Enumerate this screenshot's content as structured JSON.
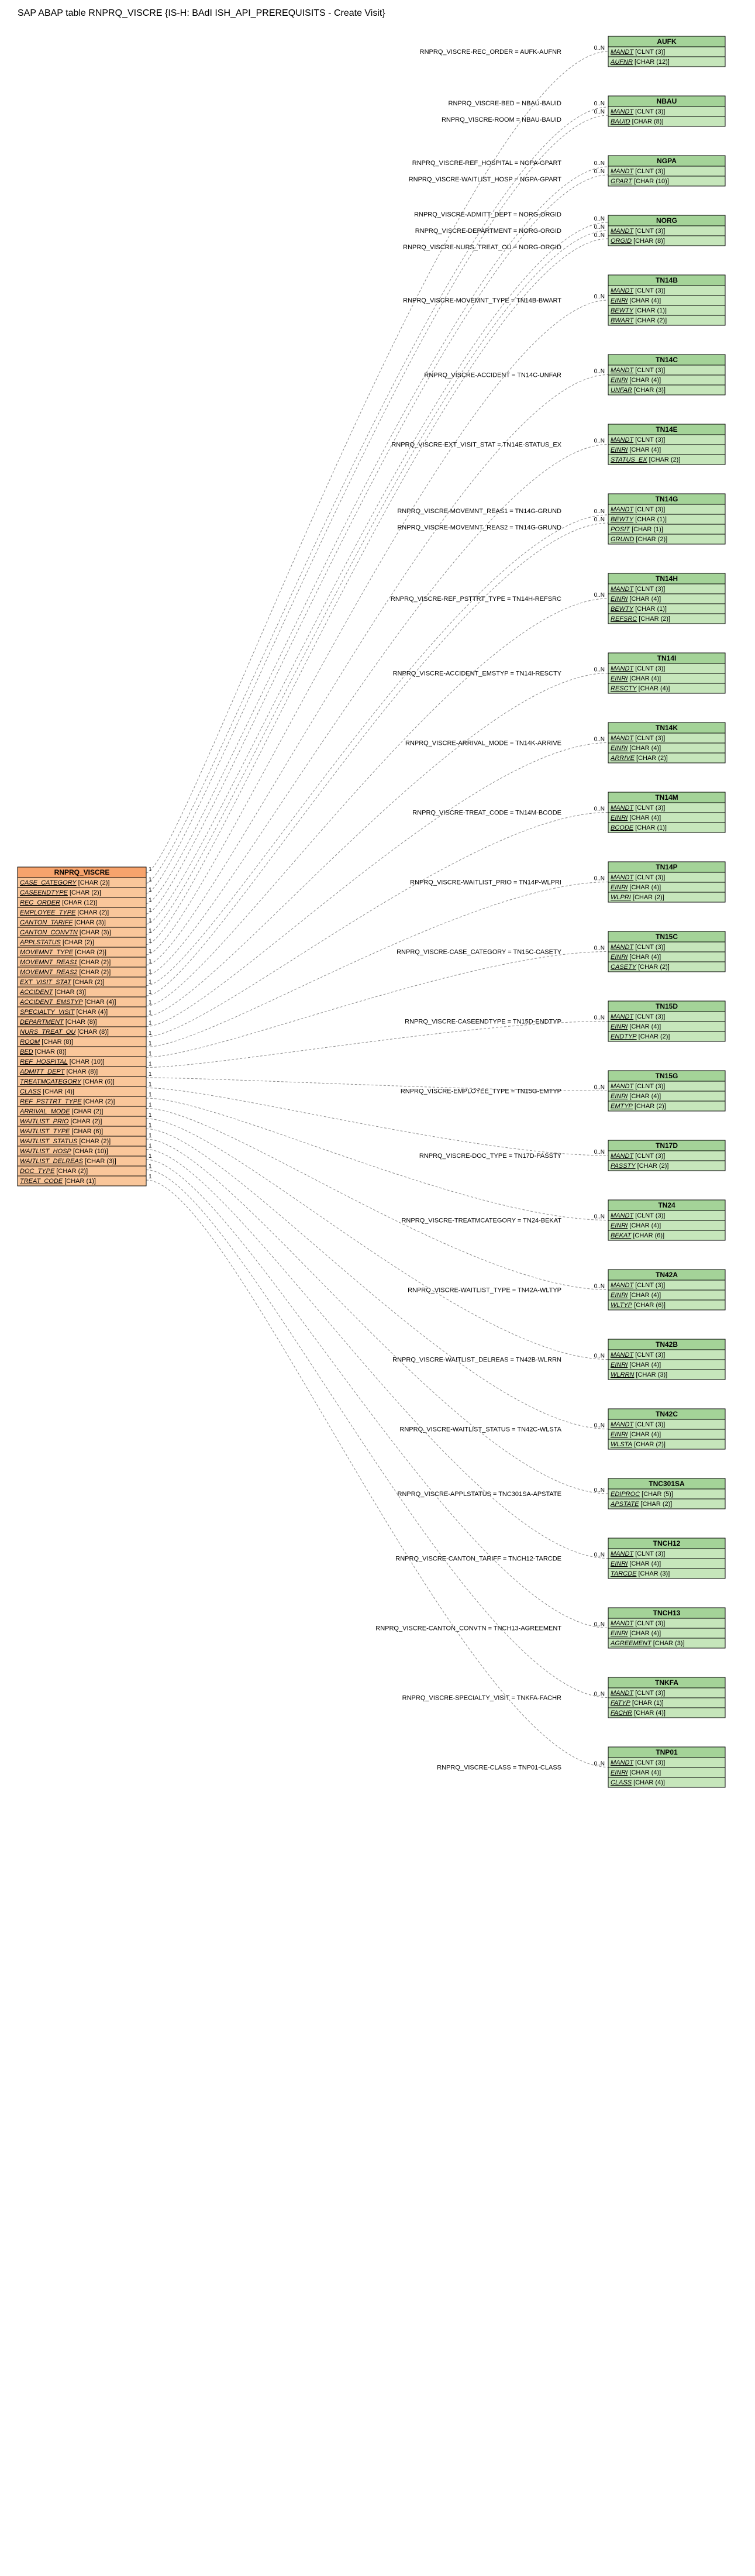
{
  "title": "SAP ABAP table RNPRQ_VISCRE {IS-H: BAdI ISH_API_PREREQUISITS - Create Visit}",
  "main_table": {
    "name": "RNPRQ_VISCRE",
    "fields": [
      "CASE_CATEGORY [CHAR (2)]",
      "CASEENDTYPE [CHAR (2)]",
      "REC_ORDER [CHAR (12)]",
      "EMPLOYEE_TYPE [CHAR (2)]",
      "CANTON_TARIFF [CHAR (3)]",
      "CANTON_CONVTN [CHAR (3)]",
      "APPLSTATUS [CHAR (2)]",
      "MOVEMNT_TYPE [CHAR (2)]",
      "MOVEMNT_REAS1 [CHAR (2)]",
      "MOVEMNT_REAS2 [CHAR (2)]",
      "EXT_VISIT_STAT [CHAR (2)]",
      "ACCIDENT [CHAR (3)]",
      "ACCIDENT_EMSTYP [CHAR (4)]",
      "SPECIALTY_VISIT [CHAR (4)]",
      "DEPARTMENT [CHAR (8)]",
      "NURS_TREAT_OU [CHAR (8)]",
      "ROOM [CHAR (8)]",
      "BED [CHAR (8)]",
      "REF_HOSPITAL [CHAR (10)]",
      "ADMITT_DEPT [CHAR (8)]",
      "TREATMCATEGORY [CHAR (6)]",
      "CLASS [CHAR (4)]",
      "REF_PSTTRT_TYPE [CHAR (2)]",
      "ARRIVAL_MODE [CHAR (2)]",
      "WAITLIST_PRIO [CHAR (2)]",
      "WAITLIST_TYPE [CHAR (6)]",
      "WAITLIST_STATUS [CHAR (2)]",
      "WAITLIST_HOSP [CHAR (10)]",
      "WAITLIST_DELREAS [CHAR (3)]",
      "DOC_TYPE [CHAR (2)]",
      "TREAT_CODE [CHAR (1)]"
    ]
  },
  "targets": [
    {
      "name": "AUFK",
      "fields": [
        "MANDT [CLNT (3)]",
        "AUFNR [CHAR (12)]"
      ]
    },
    {
      "name": "NBAU",
      "fields": [
        "MANDT [CLNT (3)]",
        "BAUID [CHAR (8)]"
      ]
    },
    {
      "name": "NGPA",
      "fields": [
        "MANDT [CLNT (3)]",
        "GPART [CHAR (10)]"
      ]
    },
    {
      "name": "NORG",
      "fields": [
        "MANDT [CLNT (3)]",
        "ORGID [CHAR (8)]"
      ]
    },
    {
      "name": "TN14B",
      "fields": [
        "MANDT [CLNT (3)]",
        "EINRI [CHAR (4)]",
        "BEWTY [CHAR (1)]",
        "BWART [CHAR (2)]"
      ]
    },
    {
      "name": "TN14C",
      "fields": [
        "MANDT [CLNT (3)]",
        "EINRI [CHAR (4)]",
        "UNFAR [CHAR (3)]"
      ]
    },
    {
      "name": "TN14E",
      "fields": [
        "MANDT [CLNT (3)]",
        "EINRI [CHAR (4)]",
        "STATUS_EX [CHAR (2)]"
      ]
    },
    {
      "name": "TN14G",
      "fields": [
        "MANDT [CLNT (3)]",
        "BEWTY [CHAR (1)]",
        "POSIT [CHAR (1)]",
        "GRUND [CHAR (2)]"
      ]
    },
    {
      "name": "TN14H",
      "fields": [
        "MANDT [CLNT (3)]",
        "EINRI [CHAR (4)]",
        "BEWTY [CHAR (1)]",
        "REFSRC [CHAR (2)]"
      ]
    },
    {
      "name": "TN14I",
      "fields": [
        "MANDT [CLNT (3)]",
        "EINRI [CHAR (4)]",
        "RESCTY [CHAR (4)]"
      ]
    },
    {
      "name": "TN14K",
      "fields": [
        "MANDT [CLNT (3)]",
        "EINRI [CHAR (4)]",
        "ARRIVE [CHAR (2)]"
      ]
    },
    {
      "name": "TN14M",
      "fields": [
        "MANDT [CLNT (3)]",
        "EINRI [CHAR (4)]",
        "BCODE [CHAR (1)]"
      ]
    },
    {
      "name": "TN14P",
      "fields": [
        "MANDT [CLNT (3)]",
        "EINRI [CHAR (4)]",
        "WLPRI [CHAR (2)]"
      ]
    },
    {
      "name": "TN15C",
      "fields": [
        "MANDT [CLNT (3)]",
        "EINRI [CHAR (4)]",
        "CASETY [CHAR (2)]"
      ]
    },
    {
      "name": "TN15D",
      "fields": [
        "MANDT [CLNT (3)]",
        "EINRI [CHAR (4)]",
        "ENDTYP [CHAR (2)]"
      ]
    },
    {
      "name": "TN15G",
      "fields": [
        "MANDT [CLNT (3)]",
        "EINRI [CHAR (4)]",
        "EMTYP [CHAR (2)]"
      ]
    },
    {
      "name": "TN17D",
      "fields": [
        "MANDT [CLNT (3)]",
        "PASSTY [CHAR (2)]"
      ]
    },
    {
      "name": "TN24",
      "fields": [
        "MANDT [CLNT (3)]",
        "EINRI [CHAR (4)]",
        "BEKAT [CHAR (6)]"
      ]
    },
    {
      "name": "TN42A",
      "fields": [
        "MANDT [CLNT (3)]",
        "EINRI [CHAR (4)]",
        "WLTYP [CHAR (6)]"
      ]
    },
    {
      "name": "TN42B",
      "fields": [
        "MANDT [CLNT (3)]",
        "EINRI [CHAR (4)]",
        "WLRRN [CHAR (3)]"
      ]
    },
    {
      "name": "TN42C",
      "fields": [
        "MANDT [CLNT (3)]",
        "EINRI [CHAR (4)]",
        "WLSTA [CHAR (2)]"
      ]
    },
    {
      "name": "TNC301SA",
      "fields": [
        "EDIPROC [CHAR (5)]",
        "APSTATE [CHAR (2)]"
      ]
    },
    {
      "name": "TNCH12",
      "fields": [
        "MANDT [CLNT (3)]",
        "EINRI [CHAR (4)]",
        "TARCDE [CHAR (3)]"
      ]
    },
    {
      "name": "TNCH13",
      "fields": [
        "MANDT [CLNT (3)]",
        "EINRI [CHAR (4)]",
        "AGREEMENT [CHAR (3)]"
      ]
    },
    {
      "name": "TNKFA",
      "fields": [
        "MANDT [CLNT (3)]",
        "FATYP [CHAR (1)]",
        "FACHR [CHAR (4)]"
      ]
    },
    {
      "name": "TNP01",
      "fields": [
        "MANDT [CLNT (3)]",
        "EINRI [CHAR (4)]",
        "CLASS [CHAR (4)]"
      ]
    }
  ],
  "edges": [
    {
      "label": "RNPRQ_VISCRE-REC_ORDER = AUFK-AUFNR",
      "target": 0
    },
    {
      "label": "RNPRQ_VISCRE-BED = NBAU-BAUID",
      "target": 1
    },
    {
      "label": "RNPRQ_VISCRE-ROOM = NBAU-BAUID",
      "target": 1
    },
    {
      "label": "RNPRQ_VISCRE-REF_HOSPITAL = NGPA-GPART",
      "target": 2
    },
    {
      "label": "RNPRQ_VISCRE-WAITLIST_HOSP = NGPA-GPART",
      "target": 2
    },
    {
      "label": "RNPRQ_VISCRE-ADMITT_DEPT = NORG-ORGID",
      "target": 3
    },
    {
      "label": "RNPRQ_VISCRE-DEPARTMENT = NORG-ORGID",
      "target": 3
    },
    {
      "label": "RNPRQ_VISCRE-NURS_TREAT_OU = NORG-ORGID",
      "target": 3
    },
    {
      "label": "RNPRQ_VISCRE-MOVEMNT_TYPE = TN14B-BWART",
      "target": 4
    },
    {
      "label": "RNPRQ_VISCRE-ACCIDENT = TN14C-UNFAR",
      "target": 5
    },
    {
      "label": "RNPRQ_VISCRE-EXT_VISIT_STAT = TN14E-STATUS_EX",
      "target": 6
    },
    {
      "label": "RNPRQ_VISCRE-MOVEMNT_REAS1 = TN14G-GRUND",
      "target": 7
    },
    {
      "label": "RNPRQ_VISCRE-MOVEMNT_REAS2 = TN14G-GRUND",
      "target": 7
    },
    {
      "label": "RNPRQ_VISCRE-REF_PSTTRT_TYPE = TN14H-REFSRC",
      "target": 8
    },
    {
      "label": "RNPRQ_VISCRE-ACCIDENT_EMSTYP = TN14I-RESCTY",
      "target": 9
    },
    {
      "label": "RNPRQ_VISCRE-ARRIVAL_MODE = TN14K-ARRIVE",
      "target": 10
    },
    {
      "label": "RNPRQ_VISCRE-TREAT_CODE = TN14M-BCODE",
      "target": 11
    },
    {
      "label": "RNPRQ_VISCRE-WAITLIST_PRIO = TN14P-WLPRI",
      "target": 12
    },
    {
      "label": "RNPRQ_VISCRE-CASE_CATEGORY = TN15C-CASETY",
      "target": 13
    },
    {
      "label": "RNPRQ_VISCRE-CASEENDTYPE = TN15D-ENDTYP",
      "target": 14
    },
    {
      "label": "RNPRQ_VISCRE-EMPLOYEE_TYPE = TN15G-EMTYP",
      "target": 15
    },
    {
      "label": "RNPRQ_VISCRE-DOC_TYPE = TN17D-PASSTY",
      "target": 16
    },
    {
      "label": "RNPRQ_VISCRE-TREATMCATEGORY = TN24-BEKAT",
      "target": 17
    },
    {
      "label": "RNPRQ_VISCRE-WAITLIST_TYPE = TN42A-WLTYP",
      "target": 18
    },
    {
      "label": "RNPRQ_VISCRE-WAITLIST_DELREAS = TN42B-WLRRN",
      "target": 19
    },
    {
      "label": "RNPRQ_VISCRE-WAITLIST_STATUS = TN42C-WLSTA",
      "target": 20
    },
    {
      "label": "RNPRQ_VISCRE-APPLSTATUS = TNC301SA-APSTATE",
      "target": 21
    },
    {
      "label": "RNPRQ_VISCRE-CANTON_TARIFF = TNCH12-TARCDE",
      "target": 22
    },
    {
      "label": "RNPRQ_VISCRE-CANTON_CONVTN = TNCH13-AGREEMENT",
      "target": 23
    },
    {
      "label": "RNPRQ_VISCRE-SPECIALTY_VISIT = TNKFA-FACHR",
      "target": 24
    },
    {
      "label": "RNPRQ_VISCRE-CLASS = TNP01-CLASS",
      "target": 25
    }
  ],
  "card_left": "1",
  "card_right": "0..N"
}
